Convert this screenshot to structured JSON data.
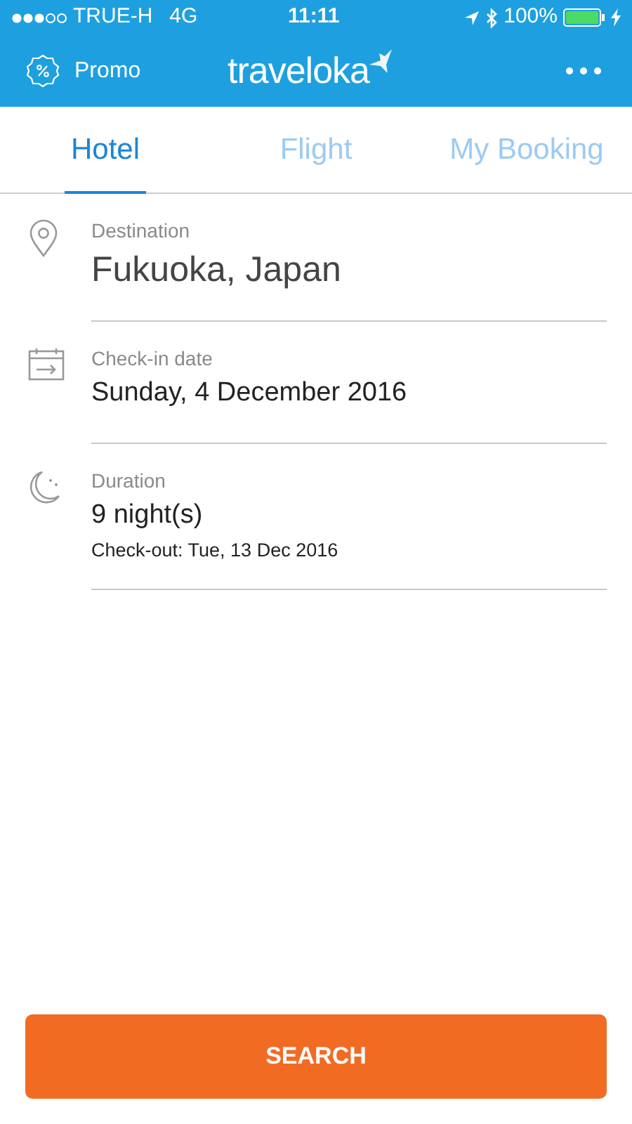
{
  "status_bar": {
    "carrier": "TRUE-H",
    "network": "4G",
    "time": "11:11",
    "battery": "100%"
  },
  "header": {
    "promo": "Promo",
    "logo": "traveloka"
  },
  "tabs": [
    {
      "label": "Hotel",
      "selected": true
    },
    {
      "label": "Flight",
      "selected": false
    },
    {
      "label": "My Booking",
      "selected": false
    }
  ],
  "fields": [
    {
      "kind": "destination",
      "label": "Destination",
      "value": "Fukuoka, Japan"
    },
    {
      "kind": "date",
      "label": "Check-in date",
      "value": "Sunday, 4 December 2016"
    },
    {
      "kind": "duration",
      "label": "Duration",
      "value": "9 night(s)",
      "note": "Check-out: Tue, 13 Dec 2016"
    }
  ],
  "search_button": "SEARCH"
}
